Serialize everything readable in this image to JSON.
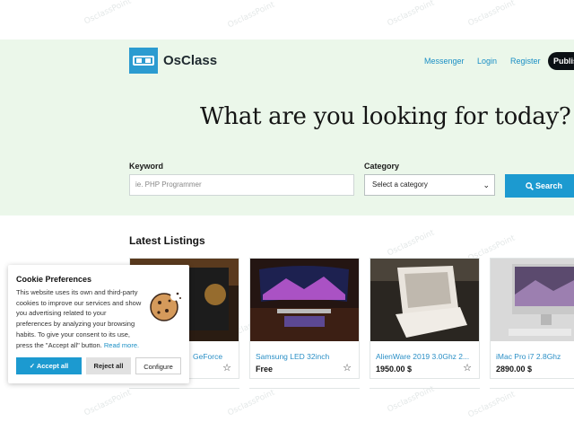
{
  "site": {
    "logo_text": "OsClass"
  },
  "nav": {
    "messenger": "Messenger",
    "login": "Login",
    "register": "Register",
    "publish": "Publis"
  },
  "hero": {
    "title": "What are you looking for today?",
    "keyword_label": "Keyword",
    "keyword_placeholder": "ie. PHP Programmer",
    "category_label": "Category",
    "category_value": "Select a category",
    "search_button": "Search"
  },
  "listings": {
    "section_title": "Latest Listings",
    "items": [
      {
        "title": "GeForce",
        "price": ""
      },
      {
        "title": "Samsung LED 32inch",
        "price": "Free"
      },
      {
        "title": "AlienWare 2019 3.0Ghz 2...",
        "price": "1950.00 $"
      },
      {
        "title": "iMac Pro i7 2.8Ghz",
        "price": "2890.00 $"
      }
    ]
  },
  "cookie": {
    "heading": "Cookie Preferences",
    "text": "This website uses its own and third-party cookies to improve our services and show you advertising related to your preferences by analyzing your browsing habits. To give your consent to its use, press the \"Accept all\" button.",
    "read_more": "Read more.",
    "accept": "✓ Accept all",
    "reject": "Reject all",
    "configure": "Configure"
  },
  "watermark": "OsclassPoint",
  "colors": {
    "accent": "#1c9ad0",
    "hero_bg": "#ebf7ea",
    "dark": "#0b1014"
  }
}
